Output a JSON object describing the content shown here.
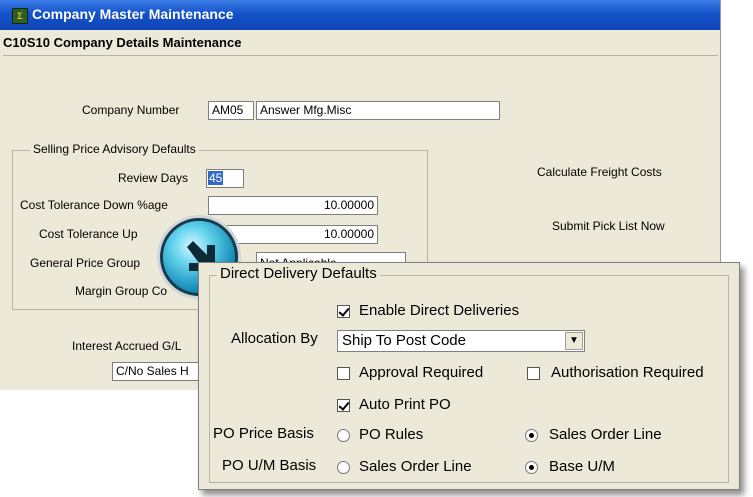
{
  "window": {
    "title": "Company Master Maintenance",
    "subtitle": "C10S10 Company Details Maintenance"
  },
  "company": {
    "label": "Company Number",
    "code": "AM05",
    "name": "Answer Mfg.Misc"
  },
  "advisory": {
    "title": "Selling Price Advisory Defaults",
    "review_days_label": "Review Days",
    "review_days_value": "45",
    "cost_down_label": "Cost Tolerance Down %age",
    "cost_down_value": "10.00000",
    "cost_up_label": "Cost Tolerance Up",
    "cost_up_value": "10.00000",
    "general_price_label": "General Price Group",
    "general_price_value": "Not Applicable",
    "margin_group_label": "Margin Group Co"
  },
  "right_labels": {
    "calc_freight": "Calculate Freight Costs",
    "submit_pick": "Submit Pick List Now"
  },
  "interest": {
    "label": "Interest Accrued G/L",
    "field_value": "C/No Sales H"
  },
  "direct_delivery": {
    "title": "Direct Delivery Defaults",
    "enable_label": "Enable Direct Deliveries",
    "enable_checked": true,
    "allocation_label": "Allocation By",
    "allocation_value": "Ship To Post Code",
    "approval_label": "Approval Required",
    "approval_checked": false,
    "authorisation_label": "Authorisation Required",
    "authorisation_checked": false,
    "auto_print_label": "Auto Print PO",
    "auto_print_checked": true,
    "po_price_label": "PO Price Basis",
    "po_price_opt1": "PO Rules",
    "po_price_opt2": "Sales Order Line",
    "po_price_selected": "Sales Order Line",
    "po_um_label": "PO U/M Basis",
    "po_um_opt1": "Sales Order Line",
    "po_um_opt2": "Base U/M",
    "po_um_selected": "Base U/M"
  },
  "colors": {
    "titlebar": "#1452c9",
    "panel": "#ece9d8",
    "highlight": "#316ac5"
  },
  "icons": {
    "window": "app-icon",
    "magnifier": "magnifier-icon"
  }
}
